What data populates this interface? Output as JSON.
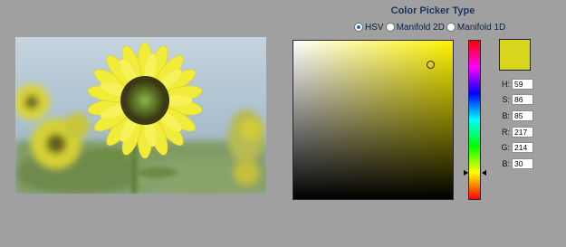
{
  "image": {
    "subject": "sunflower photo"
  },
  "picker": {
    "title": "Color Picker Type",
    "types": [
      {
        "label": "HSV",
        "selected": true
      },
      {
        "label": "Manifold 2D",
        "selected": false
      },
      {
        "label": "Manifold 1D",
        "selected": false
      }
    ]
  },
  "color": {
    "swatch": "#d9d61e",
    "h": "59",
    "s": "86",
    "b": "85",
    "r": "217",
    "g": "214",
    "b2": "30",
    "hue_base": "#fff200"
  },
  "labels": {
    "h": "H:",
    "s": "S:",
    "b": "B:",
    "r": "R:",
    "g": "G:",
    "b2": "B:"
  }
}
